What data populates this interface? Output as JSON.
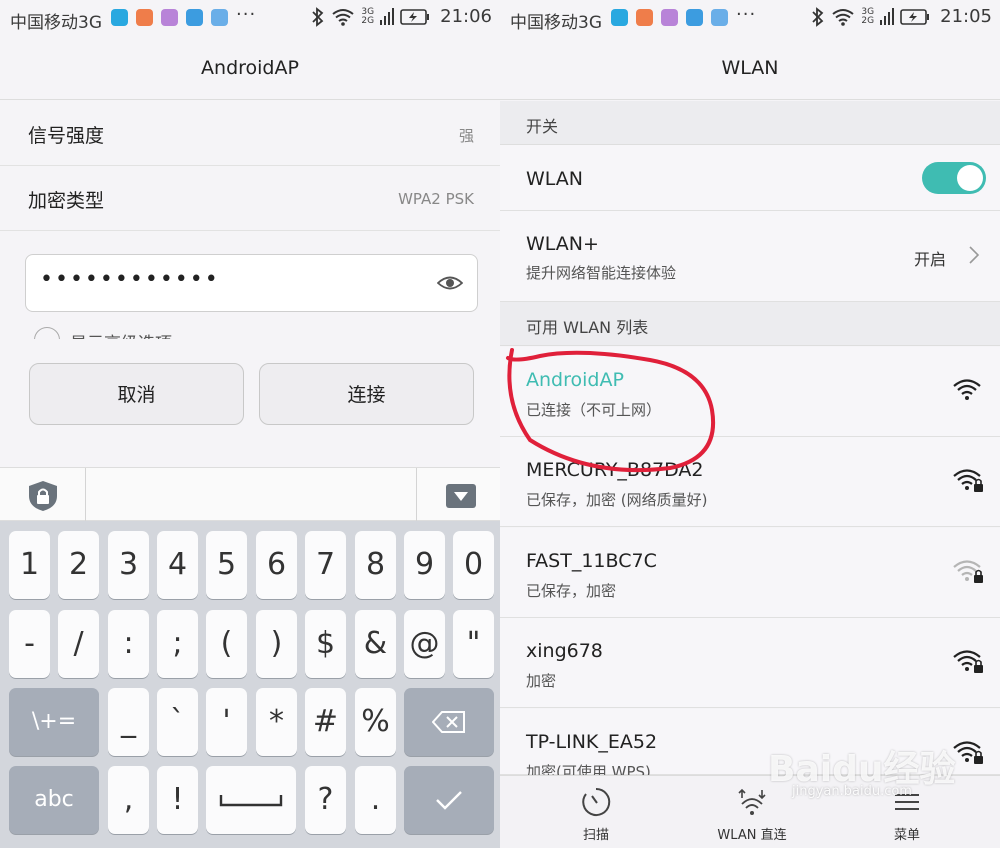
{
  "left_status": {
    "carrier": "中国移动3G",
    "time": "21:06",
    "network_small": [
      "3G",
      "2G"
    ],
    "app_icon_colors": [
      "#29a8e0",
      "#ef7d4a",
      "#b883d8",
      "#3c9ce0",
      "#6aaee8"
    ]
  },
  "right_status": {
    "carrier": "中国移动3G",
    "time": "21:05",
    "network_small": [
      "3G",
      "2G"
    ]
  },
  "left": {
    "title": "AndroidAP",
    "rows": [
      {
        "label": "信号强度",
        "value": "强"
      },
      {
        "label": "加密类型",
        "value": "WPA2 PSK"
      }
    ],
    "password_mask": "••••••••••••",
    "show_advanced": "显示高级选项",
    "cancel": "取消",
    "connect": "连接"
  },
  "keyboard": {
    "row1": [
      "1",
      "2",
      "3",
      "4",
      "5",
      "6",
      "7",
      "8",
      "9",
      "0"
    ],
    "row2": [
      "-",
      "/",
      ":",
      ";",
      "(",
      ")",
      "$",
      "&",
      "@",
      "\""
    ],
    "row3": [
      "\\+=",
      "_",
      "`",
      "'",
      "*",
      "#",
      "%"
    ],
    "row4": [
      "abc",
      ",",
      "!",
      "?",
      "."
    ]
  },
  "right": {
    "title": "WLAN",
    "section_switch": "开关",
    "wlan_label": "WLAN",
    "wlan_on": true,
    "wlanplus_label": "WLAN+",
    "wlanplus_sub": "提升网络智能连接体验",
    "wlanplus_value": "开启",
    "section_list": "可用 WLAN 列表",
    "networks": [
      {
        "name": "AndroidAP",
        "status": "已连接（不可上网）",
        "locked": false,
        "active": true
      },
      {
        "name": "MERCURY_B87DA2",
        "status": "已保存，加密 (网络质量好)",
        "locked": true,
        "active": false
      },
      {
        "name": "FAST_11BC7C",
        "status": "已保存，加密",
        "locked": true,
        "active": false
      },
      {
        "name": "xing678",
        "status": "加密",
        "locked": true,
        "active": false
      },
      {
        "name": "TP-LINK_EA52",
        "status": "加密(可使用 WPS)",
        "locked": true,
        "active": false
      }
    ],
    "bottom": [
      {
        "label": "扫描",
        "icon": "scan-icon"
      },
      {
        "label": "WLAN 直连",
        "icon": "wifi-direct-icon"
      },
      {
        "label": "菜单",
        "icon": "menu-icon"
      }
    ]
  },
  "watermark": {
    "brand": "Baidu经验",
    "url": "jingyan.baidu.com"
  },
  "colors": {
    "accent": "#3fbcb2",
    "annotation": "#e0203a",
    "key_dark": "#a6adb8"
  }
}
